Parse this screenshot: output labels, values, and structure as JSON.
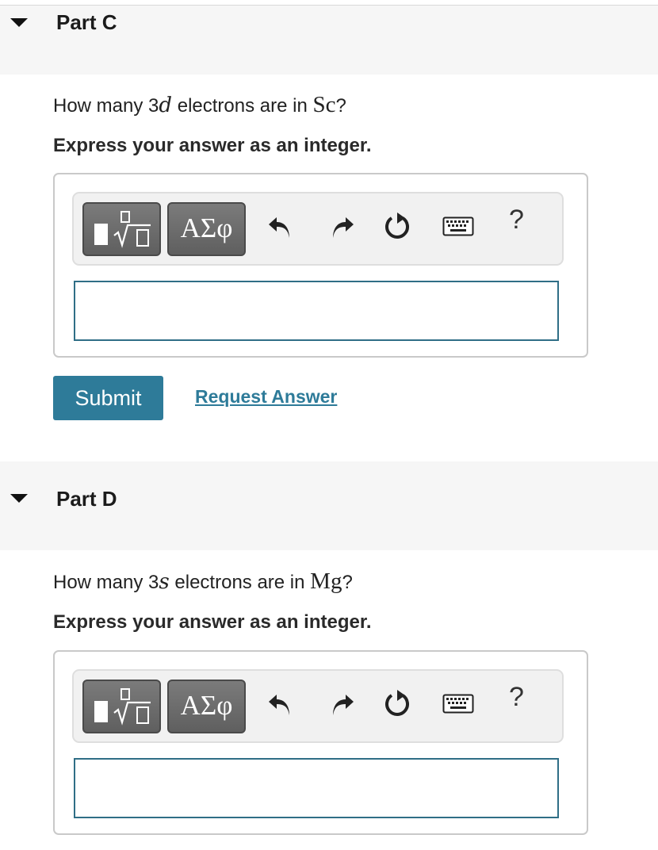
{
  "colors": {
    "accent": "#2e7b99",
    "header_bg": "#f6f6f6",
    "input_border": "#2f6e86"
  },
  "part_c": {
    "title": "Part C",
    "question": {
      "prefix": "How many 3",
      "orbital": "d",
      "middle": " electrons are in ",
      "element": "Sc",
      "suffix": "?"
    },
    "instruction": "Express your answer as an integer.",
    "toolbar": {
      "symbols_label": "ΑΣφ",
      "help_label": "?"
    },
    "answer_value": "",
    "submit_label": "Submit",
    "request_label": "Request Answer"
  },
  "part_d": {
    "title": "Part D",
    "question": {
      "prefix": "How many 3",
      "orbital": "s",
      "middle": " electrons are in ",
      "element": "Mg",
      "suffix": "?"
    },
    "instruction": "Express your answer as an integer.",
    "toolbar": {
      "symbols_label": "ΑΣφ",
      "help_label": "?"
    },
    "answer_value": ""
  }
}
